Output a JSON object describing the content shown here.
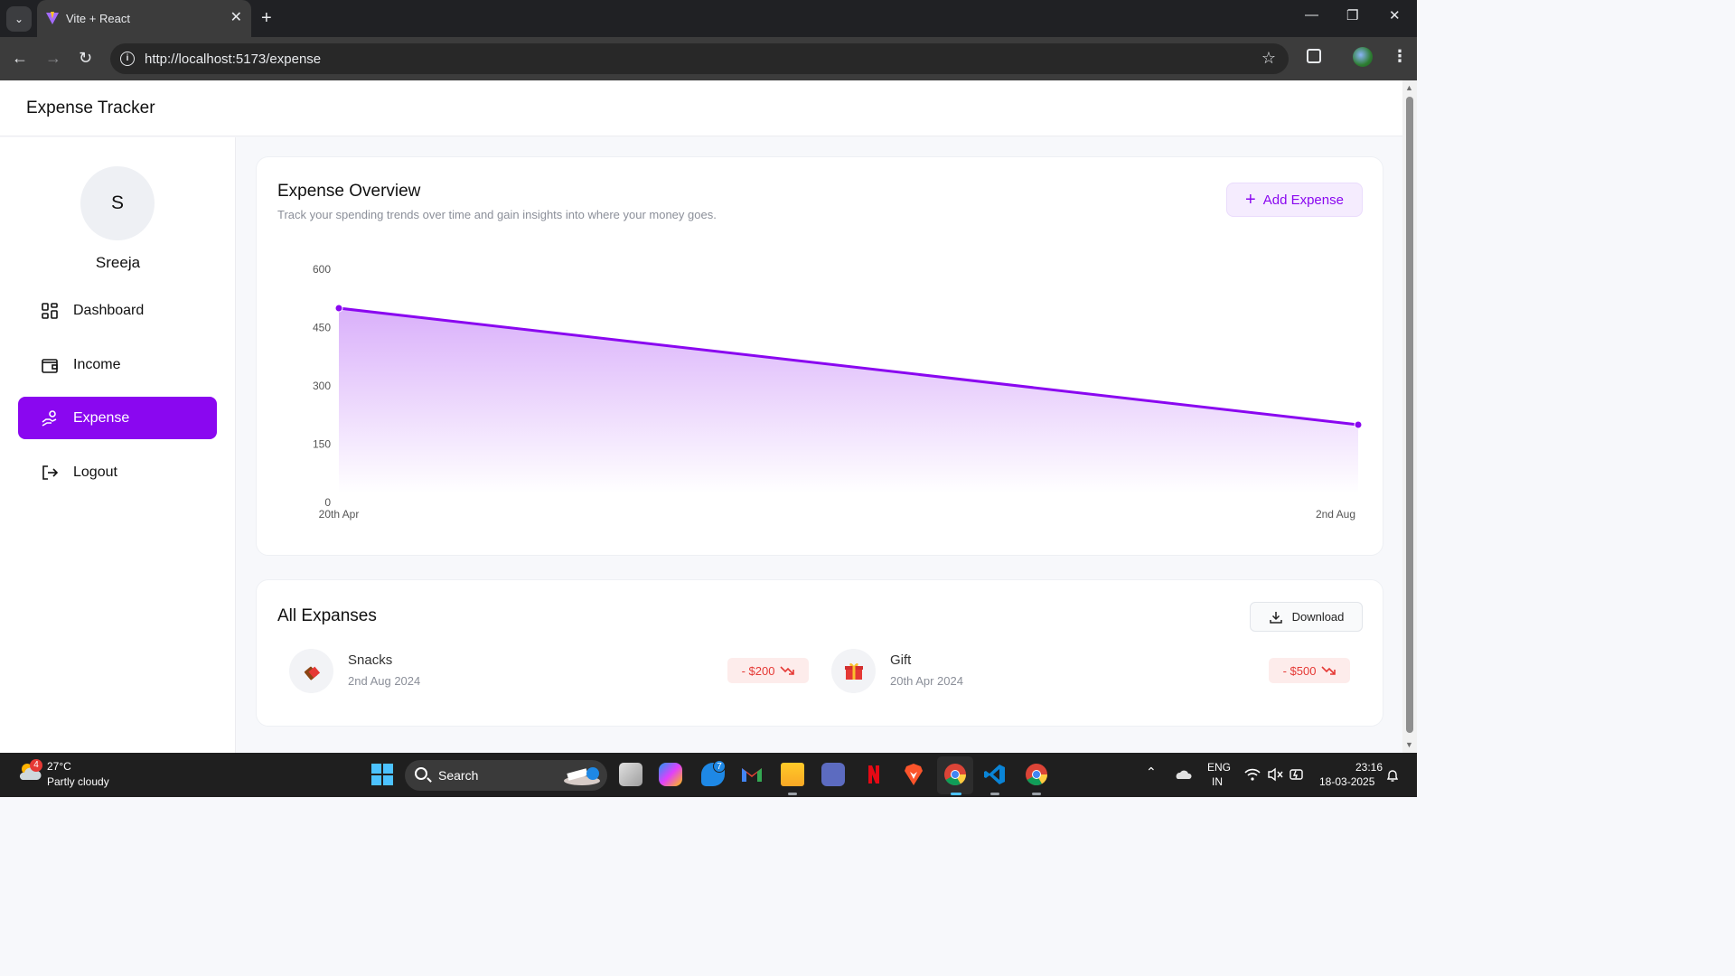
{
  "browser": {
    "tab_title": "Vite + React",
    "url": "http://localhost:5173/expense"
  },
  "app": {
    "title": "Expense Tracker"
  },
  "user": {
    "initial": "S",
    "name": "Sreeja"
  },
  "sidebar": {
    "items": [
      {
        "label": "Dashboard",
        "icon": "dashboard-icon",
        "active": false
      },
      {
        "label": "Income",
        "icon": "wallet-icon",
        "active": false
      },
      {
        "label": "Expense",
        "icon": "hand-coins-icon",
        "active": true
      },
      {
        "label": "Logout",
        "icon": "logout-icon",
        "active": false
      }
    ]
  },
  "overview": {
    "title": "Expense Overview",
    "subtitle": "Track your spending trends over time and gain insights into where your money goes.",
    "add_button": "Add Expense"
  },
  "chart_data": {
    "type": "area",
    "title": "",
    "xlabel": "",
    "ylabel": "",
    "categories": [
      "20th Apr",
      "2nd Aug"
    ],
    "series": [
      {
        "values": [
          500,
          200
        ]
      }
    ],
    "yticks": [
      0,
      150,
      300,
      450,
      600
    ],
    "ylim": [
      0,
      600
    ],
    "grid": false,
    "color": "#8a07f0"
  },
  "expenses": {
    "title": "All Expanses",
    "download_label": "Download",
    "items": [
      {
        "name": "Snacks",
        "date": "2nd Aug 2024",
        "amount": "- $200",
        "icon": "chocolate-icon"
      },
      {
        "name": "Gift",
        "date": "20th Apr 2024",
        "amount": "- $500",
        "icon": "gift-icon"
      }
    ]
  },
  "taskbar": {
    "weather_badge": "4",
    "temperature": "27°C",
    "condition": "Partly cloudy",
    "search_label": "Search",
    "lang_top": "ENG",
    "lang_bottom": "IN",
    "time": "23:16",
    "date": "18-03-2025",
    "badge_todo": "7"
  },
  "colors": {
    "accent": "#8a07f0",
    "danger": "#e53935"
  }
}
